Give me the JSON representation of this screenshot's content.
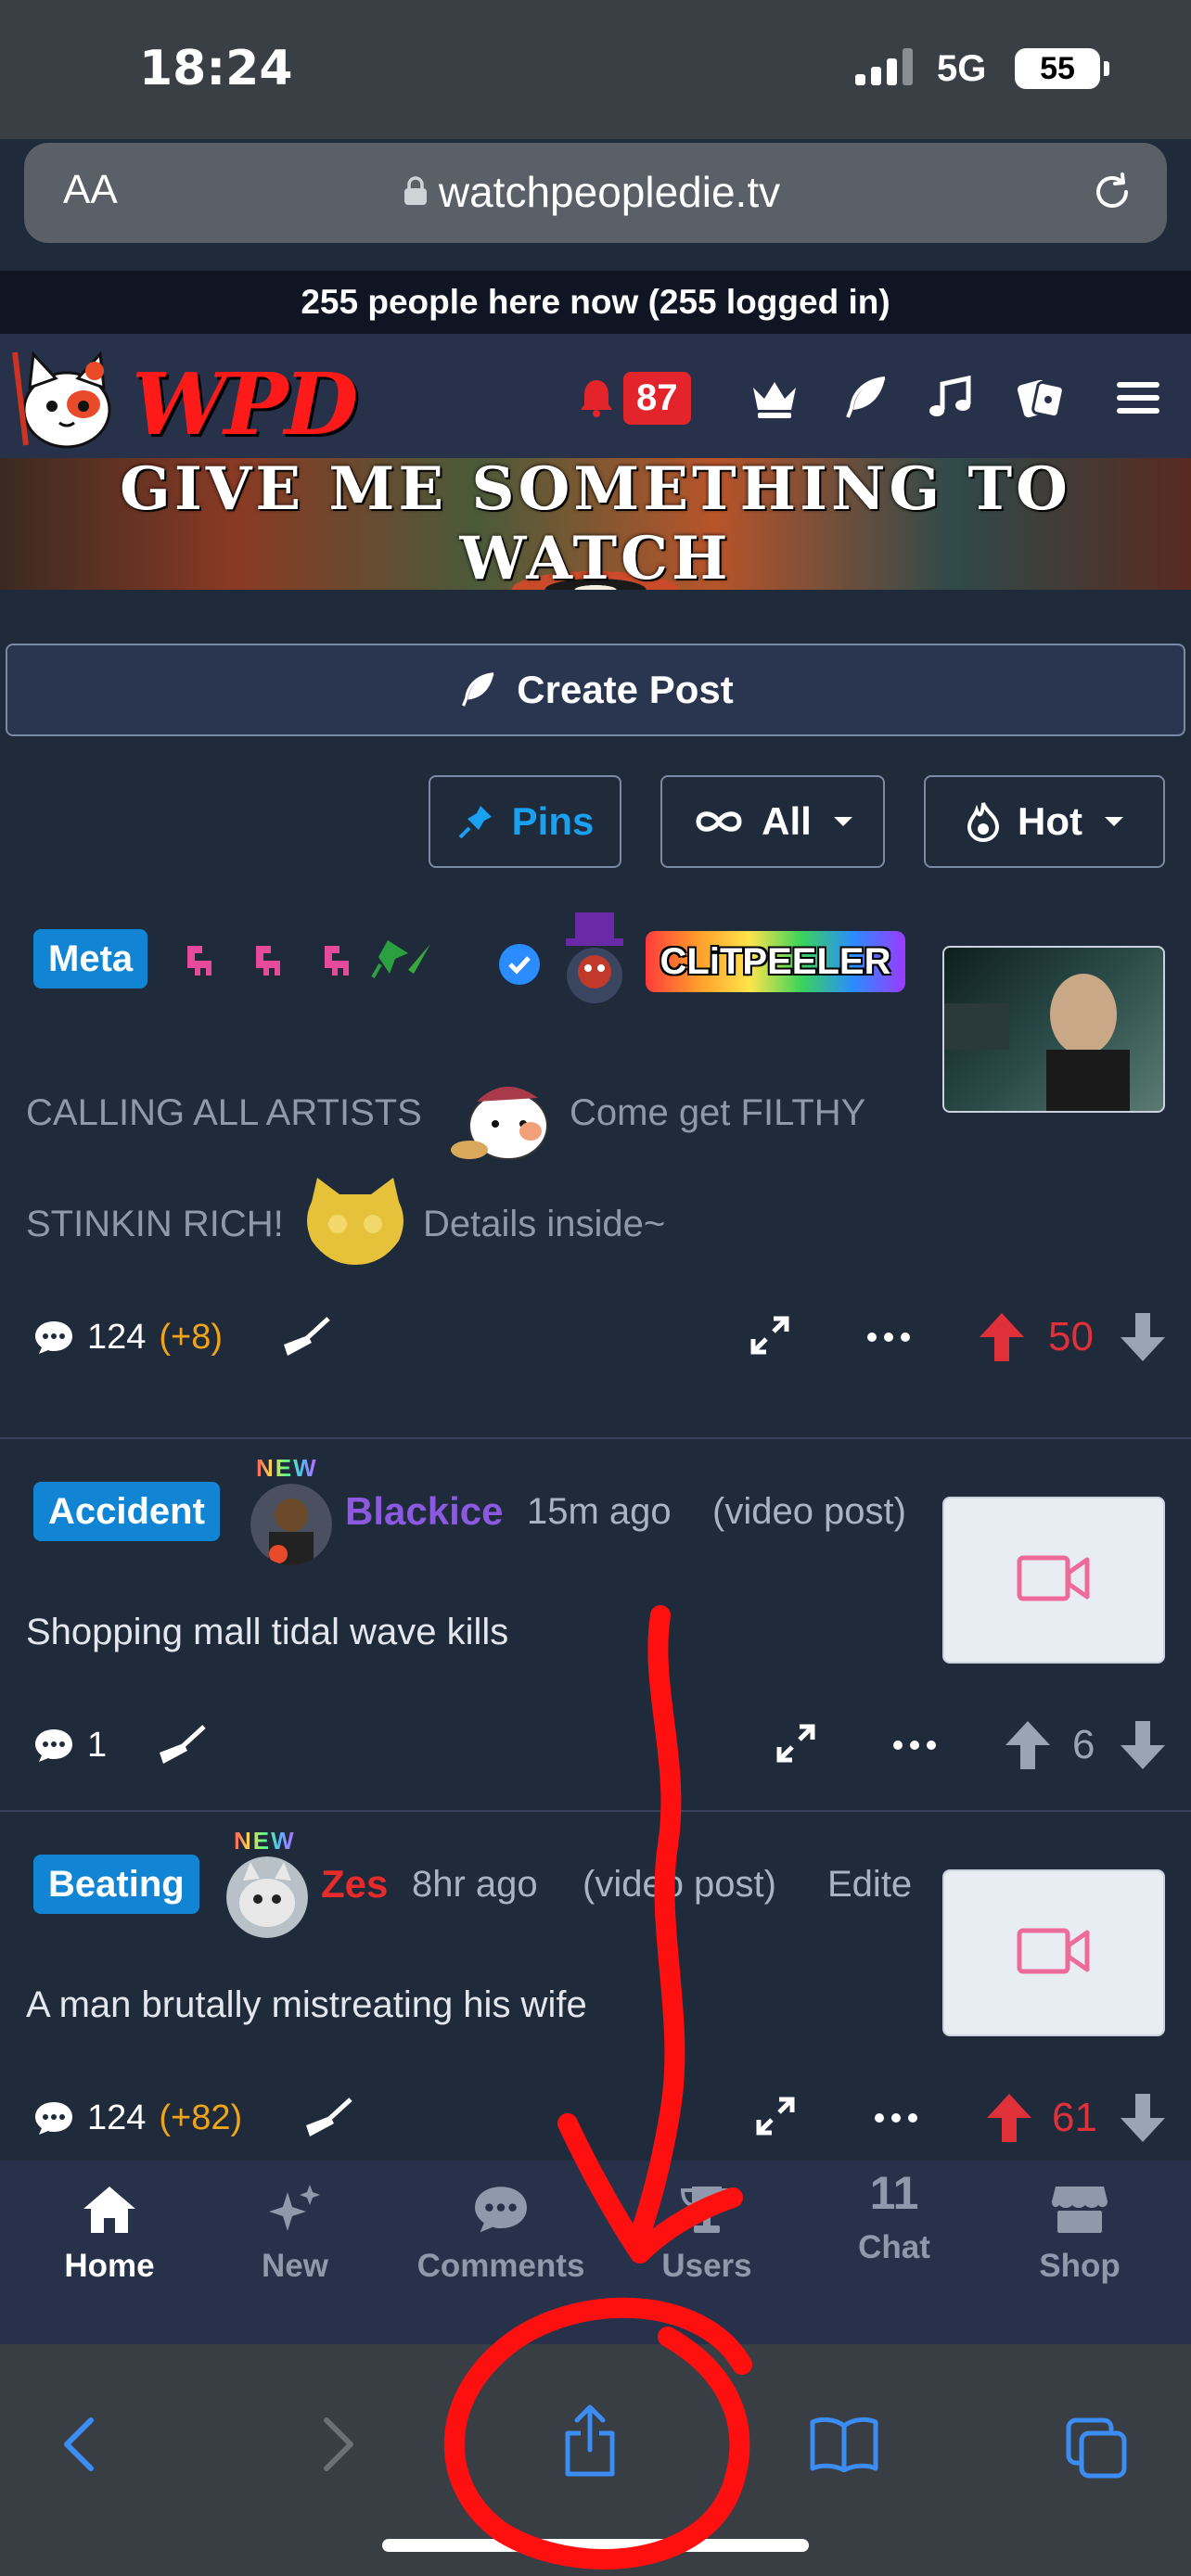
{
  "status_bar": {
    "time": "18:24",
    "network": "5G",
    "battery": "55"
  },
  "address_bar": {
    "text_size_label": "AA",
    "url": "watchpeopledie.tv"
  },
  "site": {
    "online_banner": "255 people here now (255 logged in)",
    "logo_text": "WPD",
    "banner_text": "GIVE ME SOMETHING TO WATCH",
    "notification_count": "87",
    "nav_icons": [
      "crown-icon",
      "feather-icon",
      "music-icon",
      "casino-icon",
      "menu-icon"
    ]
  },
  "toolbar": {
    "create_post_label": "Create Post",
    "pins_label": "Pins",
    "all_label": "All",
    "hot_label": "Hot"
  },
  "posts": [
    {
      "flair": "Meta",
      "username": "CLiTPEELER",
      "title_part1": "CALLING ALL ARTISTS",
      "title_part2": "Come get FILTHY",
      "title_part3": "STINKIN RICH!",
      "title_part4": "Details inside~",
      "comments": "124",
      "comments_delta": "(+8)",
      "score": "50",
      "upvoted": true,
      "thumbnail": "image"
    },
    {
      "flair": "Accident",
      "new_tag": "NEW",
      "username": "Blackice",
      "age": "15m ago",
      "kind": "(video post)",
      "title": "Shopping mall tidal wave kills",
      "comments": "1",
      "score": "6",
      "upvoted": false,
      "thumbnail": "video"
    },
    {
      "flair": "Beating",
      "new_tag": "NEW",
      "username": "Zes",
      "age": "8hr ago",
      "kind": "(video post)",
      "edited": "Edite",
      "title": "A man brutally mistreating his wife",
      "comments": "124",
      "comments_delta": "(+82)",
      "score": "61",
      "upvoted": true,
      "thumbnail": "video"
    }
  ],
  "bottom_nav": {
    "home": "Home",
    "new": "New",
    "comments": "Comments",
    "users": "Users",
    "chat": "Chat",
    "chat_count": "11",
    "shop": "Shop"
  },
  "colors": {
    "page_bg": "#1f2a3a",
    "nav_bg": "#27324a",
    "flair_blue": "#1185d4",
    "upvote_red": "#e0303a",
    "delta_orange": "#f0a418",
    "safari_blue": "#3b8cf3",
    "annotation_red": "#ff1010"
  }
}
